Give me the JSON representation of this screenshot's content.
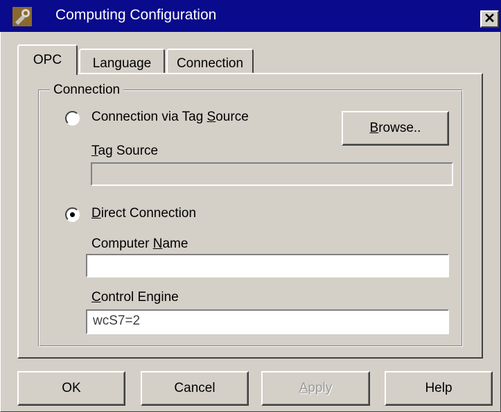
{
  "window": {
    "title": "Computing Configuration",
    "close_glyph": "✕"
  },
  "tabs": [
    {
      "label": "OPC",
      "active": true
    },
    {
      "label": "Language",
      "active": false
    },
    {
      "label": "Connection",
      "active": false
    }
  ],
  "group": {
    "label": "Connection",
    "tag_source_option": {
      "label_pre": "Connection via Tag ",
      "label_mnemonic": "S",
      "label_post": "ource",
      "selected": false
    },
    "browse_button": {
      "label_mnemonic": "B",
      "label_post": "rowse.."
    },
    "tag_source_field": {
      "label_mnemonic": "T",
      "label_post": "ag Source",
      "value": ""
    },
    "direct_option": {
      "label_mnemonic": "D",
      "label_post": "irect  Connection",
      "selected": true
    },
    "computer_name_field": {
      "label_pre": "Computer ",
      "label_mnemonic": "N",
      "label_post": "ame",
      "value": ""
    },
    "control_engine_field": {
      "label_mnemonic": "C",
      "label_post": "ontrol Engine",
      "value": "wcS7=2"
    }
  },
  "buttons": {
    "ok": "OK",
    "cancel": "Cancel",
    "apply_mnemonic": "A",
    "apply_post": "pply",
    "help": "Help"
  },
  "colors": {
    "titlebar": "#0a0a8c",
    "face": "#d4d0c8"
  }
}
